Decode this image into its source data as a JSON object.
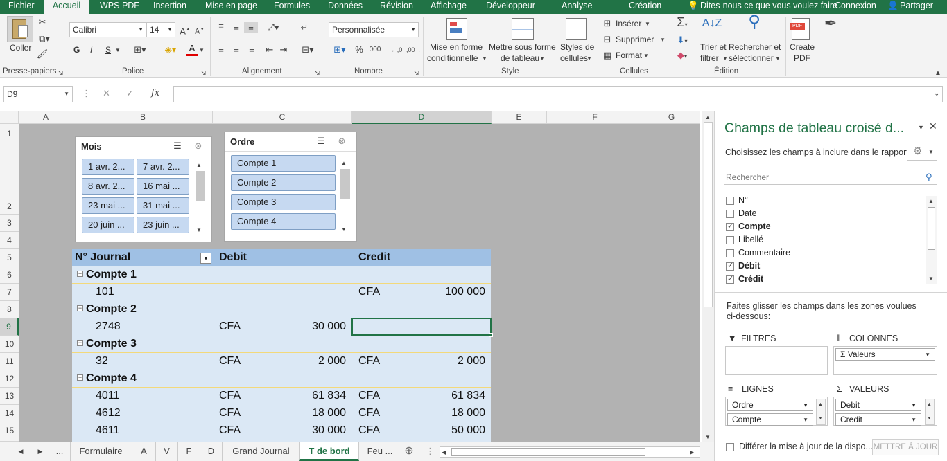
{
  "menu": {
    "tabs": [
      "Fichier",
      "Accueil",
      "WPS PDF",
      "Insertion",
      "Mise en page",
      "Formules",
      "Données",
      "Révision",
      "Affichage",
      "Développeur",
      "Analyse",
      "Création"
    ],
    "tell_me": "Dites-nous ce que vous voulez faire",
    "signin": "Connexion",
    "share": "Partager"
  },
  "ribbon": {
    "paste": "Coller",
    "clipboard": "Presse-papiers",
    "font_name": "Calibri",
    "font_size": "14",
    "bold": "G",
    "italic": "I",
    "underline": "S",
    "font_group": "Police",
    "align_group": "Alignement",
    "number_format": "Personnalisée",
    "number_group": "Nombre",
    "cond_format_1": "Mise en forme",
    "cond_format_2": "conditionnelle",
    "format_table_1": "Mettre sous forme",
    "format_table_2": "de tableau",
    "cell_styles_1": "Styles de",
    "cell_styles_2": "cellules",
    "style_group": "Style",
    "insert": "Insérer",
    "delete": "Supprimer",
    "format": "Format",
    "cells_group": "Cellules",
    "sort_1": "Trier et",
    "sort_2": "filtrer",
    "find_1": "Rechercher et",
    "find_2": "sélectionner",
    "edit_group": "Édition",
    "pdf_1": "Create",
    "pdf_2": "PDF"
  },
  "formula": {
    "namebox": "D9",
    "fx": "fx",
    "value": ""
  },
  "columns": [
    "A",
    "B",
    "C",
    "D",
    "E",
    "F",
    "G"
  ],
  "rows": [
    "1",
    "2",
    "3",
    "4",
    "5",
    "6",
    "7",
    "8",
    "9",
    "10",
    "11",
    "12",
    "13",
    "14",
    "15"
  ],
  "slicer_mois": {
    "title": "Mois",
    "items": [
      "1 avr. 2...",
      "7 avr. 2...",
      "8 avr. 2...",
      "16 mai ...",
      "23 mai ...",
      "31 mai ...",
      "20 juin ...",
      "23 juin ..."
    ]
  },
  "slicer_ordre": {
    "title": "Ordre",
    "items": [
      "Compte  1",
      "Compte  2",
      "Compte  3",
      "Compte  4"
    ]
  },
  "pivot": {
    "headers": [
      "N° Journal",
      "Debit",
      "Credit"
    ],
    "rows": [
      {
        "label": "Compte  1",
        "group": true
      },
      {
        "label": "101",
        "dcur": "",
        "dval": "",
        "ccur": "CFA",
        "cval": "100 000"
      },
      {
        "label": "Compte  2",
        "group": true
      },
      {
        "label": "2748",
        "dcur": "CFA",
        "dval": "30 000",
        "ccur": "",
        "cval": ""
      },
      {
        "label": "Compte  3",
        "group": true
      },
      {
        "label": "32",
        "dcur": "CFA",
        "dval": "2 000",
        "ccur": "CFA",
        "cval": "2 000"
      },
      {
        "label": "Compte  4",
        "group": true
      },
      {
        "label": "4011",
        "dcur": "CFA",
        "dval": "61 834",
        "ccur": "CFA",
        "cval": "61 834"
      },
      {
        "label": "4612",
        "dcur": "CFA",
        "dval": "18 000",
        "ccur": "CFA",
        "cval": "18 000"
      },
      {
        "label": "4611",
        "dcur": "CFA",
        "dval": "30 000",
        "ccur": "CFA",
        "cval": "50 000"
      }
    ]
  },
  "sheet_tabs": [
    "...",
    "Formulaire",
    "A",
    "V",
    "F",
    "D",
    "Grand Journal",
    "T de bord",
    "Feu ..."
  ],
  "panel": {
    "title": "Champs de tableau croisé d...",
    "subtitle": "Choisissez les champs à inclure dans le rapport :",
    "search_placeholder": "Rechercher",
    "fields": [
      {
        "name": "N°",
        "checked": false
      },
      {
        "name": "Date",
        "checked": false
      },
      {
        "name": "Compte",
        "checked": true
      },
      {
        "name": "Libellé",
        "checked": false
      },
      {
        "name": "Commentaire",
        "checked": false
      },
      {
        "name": "Débit",
        "checked": true
      },
      {
        "name": "Crédit",
        "checked": true
      }
    ],
    "drag_text_1": "Faites glisser les champs dans les zones voulues",
    "drag_text_2": "ci-dessous:",
    "filters": "FILTRES",
    "columns": "COLONNES",
    "rows": "LIGNES",
    "values": "VALEURS",
    "col_item": "Valeurs",
    "row_items": [
      "Ordre",
      "Compte"
    ],
    "value_items": [
      "Debit",
      "Credit"
    ],
    "defer": "Différer la mise à jour de la dispo...",
    "update": "METTRE À JOUR"
  }
}
